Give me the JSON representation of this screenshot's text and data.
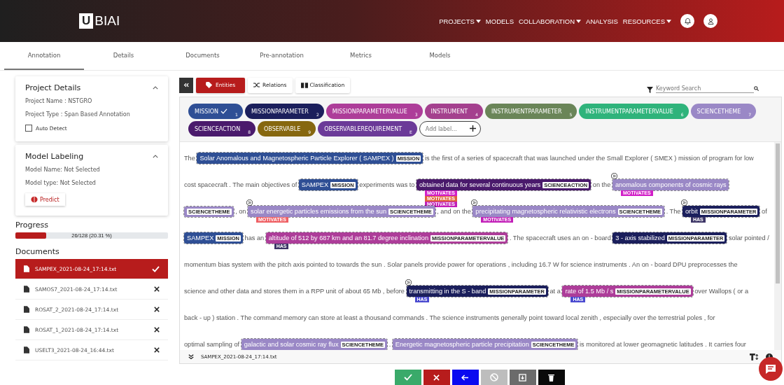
{
  "header": {
    "logo_box": "U",
    "logo_text": "BIAI",
    "nav": [
      {
        "label": "PROJECTS",
        "dropdown": true
      },
      {
        "label": "MODELS",
        "dropdown": false
      },
      {
        "label": "COLLABORATION",
        "dropdown": true
      },
      {
        "label": "ANALYSIS",
        "dropdown": false
      },
      {
        "label": "RESOURCES",
        "dropdown": true
      }
    ]
  },
  "tabs": [
    {
      "label": "Annotation",
      "selected": true
    },
    {
      "label": "Details",
      "selected": false
    },
    {
      "label": "Documents",
      "selected": false
    },
    {
      "label": "Pre-annotation",
      "selected": false
    },
    {
      "label": "Metrics",
      "selected": false
    },
    {
      "label": "Models",
      "selected": false
    }
  ],
  "sidebar": {
    "project_details": {
      "title": "Project Details",
      "expanded": true,
      "lines": [
        "Project Name : NSTGRO",
        "Project Type : Span Based Annotation"
      ],
      "auto_detect": {
        "label": "Auto Detect",
        "checked": false
      }
    },
    "model_labeling": {
      "title": "Model Labeling",
      "expanded": true,
      "lines": [
        "Model Name: Not Selected",
        "Model type: Not Selected"
      ],
      "button": "Predict"
    },
    "progress": {
      "title": "Progress",
      "level": 0.2031,
      "reading": "26/128 (20.31 %)"
    },
    "documents": {
      "title": "Documents",
      "items": [
        {
          "name": "SAMPEX_2021-08-24_17:14.txt",
          "selected": true,
          "done": true
        },
        {
          "name": "SAMOS7_2021-08-24_17:14.txt",
          "selected": false,
          "done": false
        },
        {
          "name": "ROSAT_2_2021-08-24_17:14.txt",
          "selected": false,
          "done": false
        },
        {
          "name": "ROSAT_1_2021-08-24_17:14.txt",
          "selected": false,
          "done": false
        },
        {
          "name": "USELT3_2021-08-24_16:44.txt",
          "selected": false,
          "done": false
        }
      ]
    }
  },
  "toolbar": {
    "modes": [
      {
        "label": "Entities",
        "selected": true
      },
      {
        "label": "Relations",
        "selected": false
      },
      {
        "label": "Classification",
        "selected": false
      }
    ],
    "search": {
      "placeholder": "Keyword Search"
    }
  },
  "labels": [
    {
      "name": "MISSION",
      "key": "1",
      "color": "#2f4f95",
      "selected": true
    },
    {
      "name": "MISSIONPARAMETER",
      "key": "2",
      "color": "#1b1f5c",
      "selected": false
    },
    {
      "name": "MISSIONPARAMETERVALUE",
      "key": "3",
      "color": "#ad3d99",
      "selected": false
    },
    {
      "name": "INSTRUMENT",
      "key": "4",
      "color": "#a4408e",
      "selected": false
    },
    {
      "name": "INSTRUMENTPARAMETER",
      "key": "5",
      "color": "#6a8558",
      "selected": false
    },
    {
      "name": "INSTRUMENTPARAMETERVALUE",
      "key": "6",
      "color": "#2fb37b",
      "selected": false
    },
    {
      "name": "SCIENCETHEME",
      "key": "7",
      "color": "#9a88c6",
      "selected": false
    },
    {
      "name": "SCIENCEACTION",
      "key": "8",
      "color": "#4a1a6c",
      "selected": false
    },
    {
      "name": "OBSERVABLE",
      "key": "9",
      "color": "#86670f",
      "selected": false
    },
    {
      "name": "OBSERVABLEREQUIREMENT",
      "key": "E",
      "color": "#6b3a98",
      "selected": false
    }
  ],
  "add_label": {
    "placeholder": "Add label..."
  },
  "document": {
    "lines": [
      [
        {
          "kind": "text",
          "text": "The "
        },
        {
          "kind": "entity",
          "text": "Solar Anomalous and Magnetospheric Particle Explorer ( SAMPEX )",
          "label": "MISSION",
          "color": "#2f4f95",
          "linked": false
        },
        {
          "kind": "text",
          "text": " is the first of a series of spacecraft that was launched under the Small Explorer ( SMEX ) mission of program for low"
        }
      ],
      [
        {
          "kind": "text",
          "text": "cost spacecraft . The main objectives of "
        },
        {
          "kind": "entity",
          "text": "SAMPEX",
          "label": "MISSION",
          "color": "#2f4f95",
          "linked": false
        },
        {
          "kind": "text",
          "text": " experiments was to "
        },
        {
          "kind": "entity",
          "text": "obtained data for several continuous years",
          "label": "SCIENCEACTION",
          "color": "#4a1a6c",
          "linked": false,
          "relations": [
            {
              "label": "MOTIVATES",
              "color": "#d21fc8"
            },
            {
              "label": "MOTIVATES",
              "color": "#e0603c"
            },
            {
              "label": "MOTIVATES",
              "color": "#c21fb8"
            }
          ]
        },
        {
          "kind": "text",
          "text": " on the "
        },
        {
          "kind": "entity",
          "text": "anomalous components of cosmic rays",
          "color": "#9a88c6",
          "linked": true,
          "relations": [
            {
              "label": "MOTIVATES",
              "color": "#d21fc8"
            }
          ]
        }
      ],
      [
        {
          "kind": "entity",
          "label": "SCIENCETHEME",
          "color": "#9a88c6",
          "linked": false
        },
        {
          "kind": "text",
          "text": " , on "
        },
        {
          "kind": "entity",
          "text": "solar energetic particles emissions from the sun",
          "label": "SCIENCETHEME",
          "color": "#9a88c6",
          "linked": true,
          "relations": [
            {
              "label": "MOTIVATES",
              "color": "#ef5f63"
            }
          ]
        },
        {
          "kind": "text",
          "text": " , and on the "
        },
        {
          "kind": "entity",
          "text": "precipitating magnetospheric relativistic electrons",
          "label": "SCIENCETHEME",
          "color": "#9a88c6",
          "linked": true,
          "relations": [
            {
              "label": "MOTIVATES",
              "color": "#c21fb8"
            }
          ]
        },
        {
          "kind": "text",
          "text": " . The "
        },
        {
          "kind": "entity",
          "text": "orbit",
          "label": "MISSIONPARAMETER",
          "color": "#1b1f5c",
          "linked": true,
          "relations": [
            {
              "label": "HAS",
              "color": "#3c3566"
            }
          ]
        },
        {
          "kind": "text",
          "text": " of"
        }
      ],
      [
        {
          "kind": "entity",
          "text": "SAMPEX",
          "label": "MISSION",
          "color": "#2f4f95",
          "linked": false
        },
        {
          "kind": "text",
          "text": " has an "
        },
        {
          "kind": "entity",
          "text": "altitude of 512 by 687 km and an 81.7 degree inclination",
          "label": "MISSIONPARAMETERVALUE",
          "color": "#ad3d99",
          "linked": false,
          "relations": [
            {
              "label": "HAS",
              "color": "#3c3566"
            }
          ]
        },
        {
          "kind": "text",
          "text": " . The spacecraft uses an on - board "
        },
        {
          "kind": "entity",
          "text": "3 - axis stabilized",
          "label": "MISSIONPARAMETER",
          "color": "#1b1f5c",
          "linked": false
        },
        {
          "kind": "text",
          "text": " solar pointed /"
        }
      ],
      [
        {
          "kind": "text",
          "text": "momentum bias system with the pitch axis pointed to towards the sun . Solar panels provide power for operations , including 16.7 W for science instruments . An on - board DPU preprocesses the"
        }
      ],
      [
        {
          "kind": "text",
          "text": "science and other data and stores them in a RPP unit of about 65 Mb , before "
        },
        {
          "kind": "entity",
          "text": "transmitting in the S - band",
          "label": "MISSIONPARAMETER",
          "color": "#1b1f5c",
          "linked": true,
          "relations": [
            {
              "label": "HAS",
              "color": "#4a4ad0"
            }
          ]
        },
        {
          "kind": "text",
          "text": " at a "
        },
        {
          "kind": "entity",
          "text": "rate of 1.5 Mb / s",
          "label": "MISSIONPARAMETERVALUE",
          "color": "#ad3d99",
          "linked": false,
          "relations": [
            {
              "label": "HAS",
              "color": "#4a4ad0"
            }
          ]
        },
        {
          "kind": "text",
          "text": " over Wallops ( or a"
        }
      ],
      [
        {
          "kind": "text",
          "text": "back - up ) station . The command memory can store at least a thousand commands . The science instruments generally point toward local zenith , especially over the terrestrial poles , for"
        }
      ],
      [
        {
          "kind": "text",
          "text": "optimal sampling of "
        },
        {
          "kind": "entity",
          "text": "galactic and solar cosmic ray flux",
          "label": "SCIENCETHEME",
          "color": "#9a88c6",
          "linked": false
        },
        {
          "kind": "text",
          "text": " . "
        },
        {
          "kind": "entity",
          "text": "Energetic magnetospheric particle precipitation",
          "label": "SCIENCETHEME",
          "color": "#9a88c6",
          "linked": false
        },
        {
          "kind": "text",
          "text": " is monitored at lower geomagnetic latitudes . It carries four"
        }
      ]
    ],
    "file_name": "SAMPEX_2021-08-24_17:14.txt"
  },
  "actions": [
    {
      "kind": "accept"
    },
    {
      "kind": "reject"
    },
    {
      "kind": "back"
    },
    {
      "kind": "disabled"
    },
    {
      "kind": "download"
    },
    {
      "kind": "delete"
    }
  ]
}
